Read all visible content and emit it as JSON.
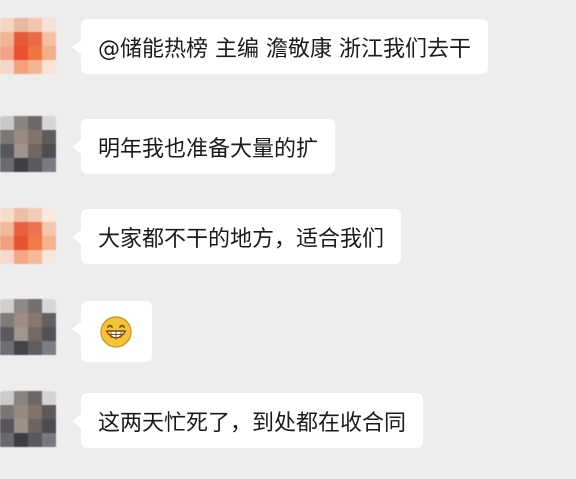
{
  "messages": [
    {
      "type": "text",
      "text": "@储能热榜 主编 澹敬康 浙江我们去干",
      "avatar": "warm"
    },
    {
      "type": "text",
      "text": "明年我也准备大量的扩",
      "avatar": "dark"
    },
    {
      "type": "text",
      "text": "大家都不干的地方，适合我们",
      "avatar": "warm"
    },
    {
      "type": "emoji",
      "emoji": "grinning-face-icon",
      "avatar": "dark"
    },
    {
      "type": "text",
      "text": "这两天忙死了，到处都在收合同",
      "avatar": "dark"
    }
  ],
  "colors": {
    "background": "#ededed",
    "bubble": "#ffffff",
    "text": "#1b1b1b",
    "emoji_fill": "#f5c338"
  }
}
